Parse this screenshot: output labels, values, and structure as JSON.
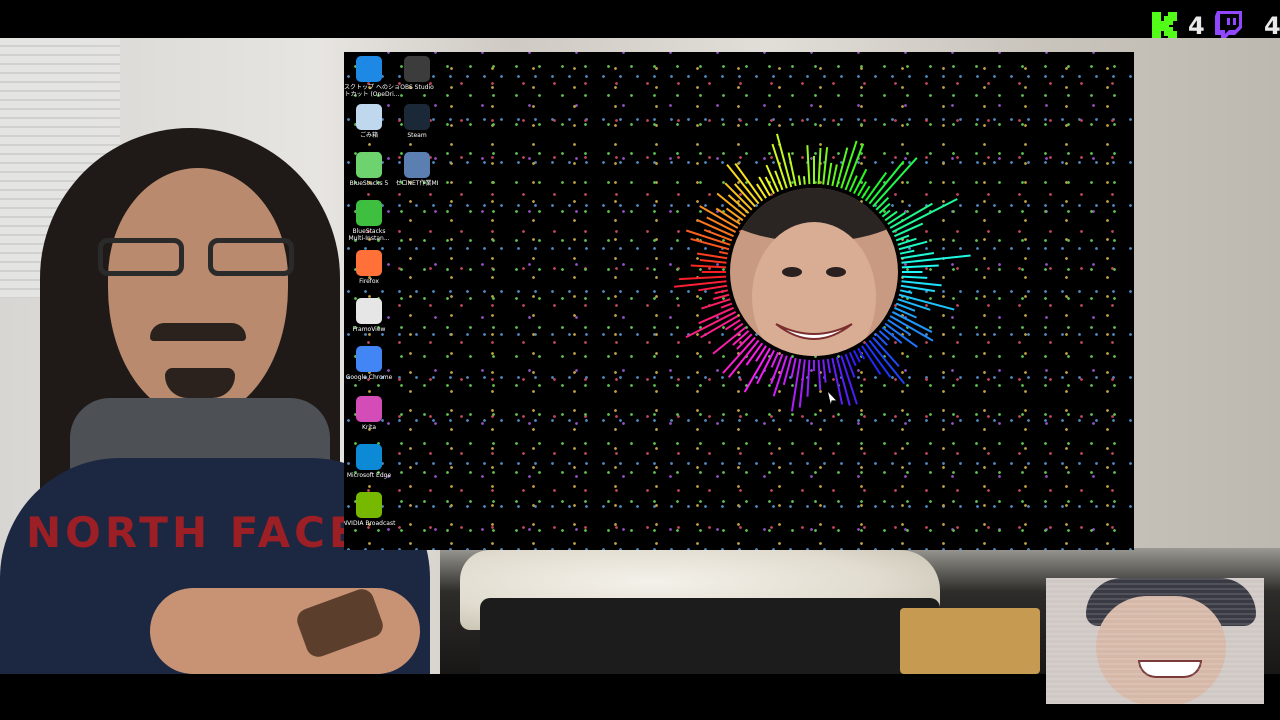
{
  "overlay": {
    "kick_viewers": "4",
    "twitch_viewers": "4",
    "kick_color": "#53fc18",
    "twitch_color": "#9146ff"
  },
  "webcam": {
    "shirt_text": "NORTH FACE"
  },
  "desktop": {
    "icons": [
      {
        "id": "onedrive",
        "label_line1": "デスクトップ へのショ",
        "label_line2": "ートカット (OneDri...",
        "icon": "onedrive-icon",
        "color": "#1e88e5"
      },
      {
        "id": "obs",
        "label_line1": "OBS Studio",
        "label_line2": "",
        "icon": "obs-icon",
        "color": "#3c3c3c"
      },
      {
        "id": "recycle",
        "label_line1": "ごみ箱",
        "label_line2": "",
        "icon": "recycle-bin-icon",
        "color": "#bfd8ee"
      },
      {
        "id": "steam",
        "label_line1": "Steam",
        "label_line2": "",
        "icon": "steam-icon",
        "color": "#1b2838"
      },
      {
        "id": "bluestacks5",
        "label_line1": "BlueStacks 5",
        "label_line2": "",
        "icon": "bluestacks-icon",
        "color": "#6ed36f"
      },
      {
        "id": "pixiv",
        "label_line1": "ゼロNET作業MI",
        "label_line2": "",
        "icon": "app-window-icon",
        "color": "#5a7fb0"
      },
      {
        "id": "bluestacks-multi",
        "label_line1": "BlueStacks",
        "label_line2": "Multi-Instan...",
        "icon": "bluestacks-multi-icon",
        "color": "#3fbf3f"
      },
      {
        "id": "firefox",
        "label_line1": "Firefox",
        "label_line2": "",
        "icon": "firefox-icon",
        "color": "#ff7139"
      },
      {
        "id": "framoview",
        "label_line1": "FramoView",
        "label_line2": "",
        "icon": "framoview-icon",
        "color": "#e6e6e6"
      },
      {
        "id": "chrome",
        "label_line1": "Google Chrome",
        "label_line2": "",
        "icon": "chrome-icon",
        "color": "#4285f4"
      },
      {
        "id": "krita",
        "label_line1": "Krita",
        "label_line2": "",
        "icon": "krita-icon",
        "color": "#d34cb7"
      },
      {
        "id": "edge",
        "label_line1": "Microsoft Edge",
        "label_line2": "",
        "icon": "edge-icon",
        "color": "#0c8ad6"
      },
      {
        "id": "nvidia",
        "label_line1": "NVIDIA Broadcast",
        "label_line2": "",
        "icon": "nvidia-icon",
        "color": "#76b900"
      }
    ]
  }
}
